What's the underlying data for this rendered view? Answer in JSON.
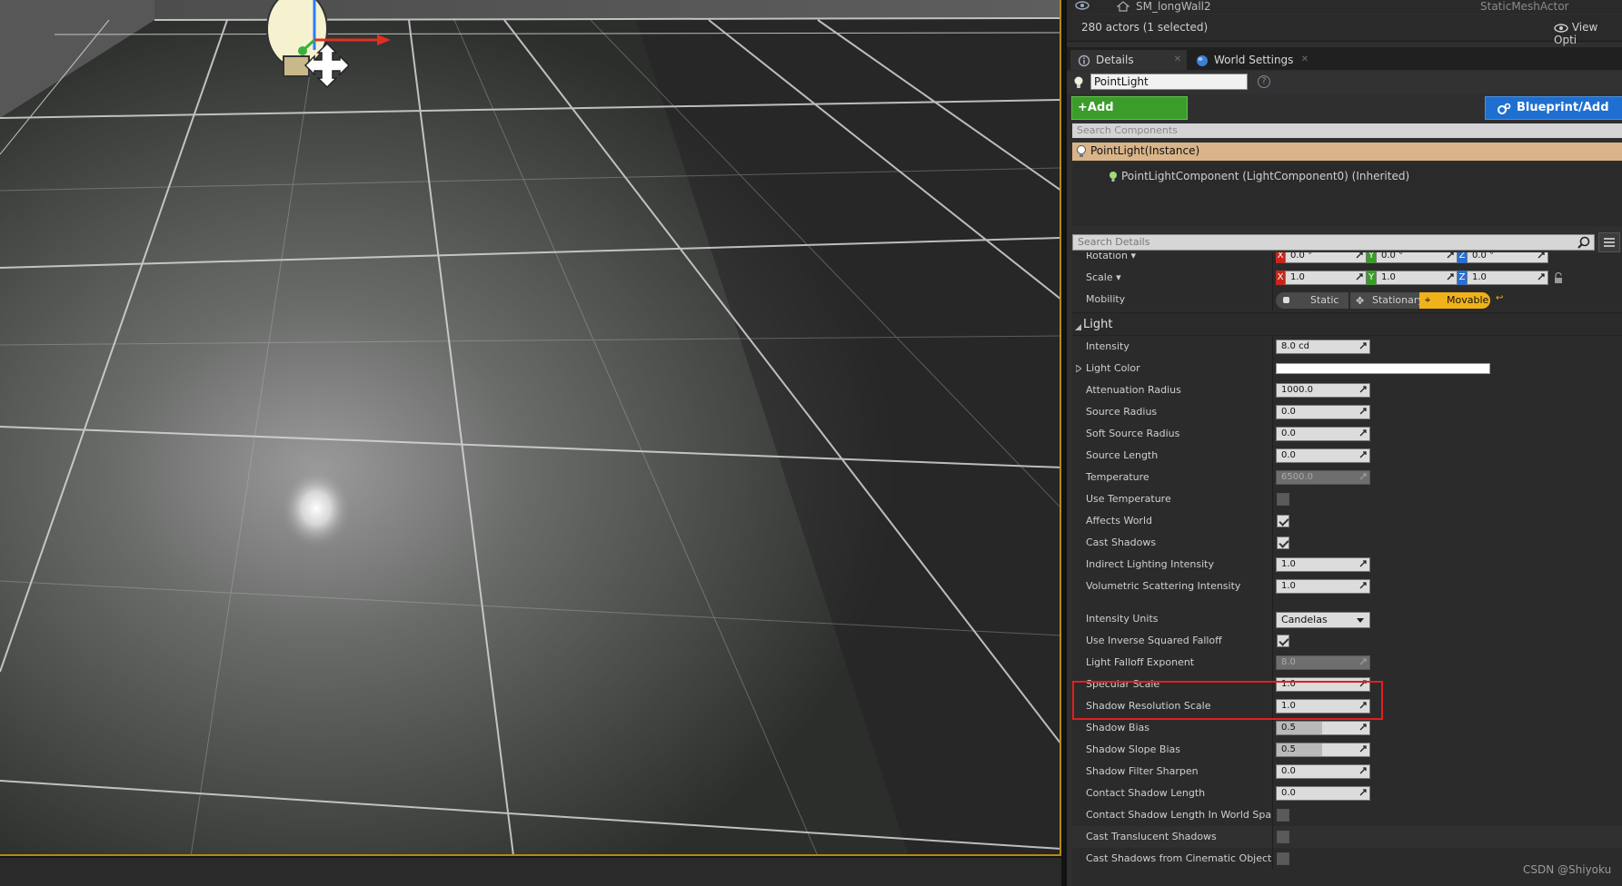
{
  "outliner": {
    "row_name": "SM_longWall2",
    "row_type": "StaticMeshActor",
    "actor_count": "280 actors (1 selected)",
    "view_options": "View Opti"
  },
  "tabs": [
    {
      "label": "Details"
    },
    {
      "label": "World Settings"
    }
  ],
  "actor_name": "PointLight",
  "toolbar": {
    "add_component": "+Add Component",
    "blueprint": "Blueprint/Add Scr"
  },
  "components": {
    "search_placeholder": "Search Components",
    "root": "PointLight(Instance)",
    "child": "PointLightComponent (LightComponent0) (Inherited)"
  },
  "details": {
    "search_placeholder": "Search Details",
    "transform": {
      "rotation_label": "Rotation",
      "rotation": {
        "x": "0.0 °",
        "y": "0.0 °",
        "z": "0.0 °"
      },
      "scale_label": "Scale",
      "scale": {
        "x": "1.0",
        "y": "1.0",
        "z": "1.0"
      },
      "mobility_label": "Mobility",
      "mobility": [
        "Static",
        "Stationary",
        "Movable"
      ]
    },
    "light_category": "Light",
    "props": {
      "intensity": {
        "label": "Intensity",
        "value": "8.0 cd"
      },
      "light_color": {
        "label": "Light Color",
        "value": "#ffffff"
      },
      "attenuation_radius": {
        "label": "Attenuation Radius",
        "value": "1000.0"
      },
      "source_radius": {
        "label": "Source Radius",
        "value": "0.0"
      },
      "soft_source_radius": {
        "label": "Soft Source Radius",
        "value": "0.0"
      },
      "source_length": {
        "label": "Source Length",
        "value": "0.0"
      },
      "temperature": {
        "label": "Temperature",
        "value": "6500.0"
      },
      "use_temperature": {
        "label": "Use Temperature"
      },
      "affects_world": {
        "label": "Affects World"
      },
      "cast_shadows": {
        "label": "Cast Shadows"
      },
      "indirect_lighting": {
        "label": "Indirect Lighting Intensity",
        "value": "1.0"
      },
      "volumetric_scattering": {
        "label": "Volumetric Scattering Intensity",
        "value": "1.0"
      },
      "intensity_units": {
        "label": "Intensity Units",
        "value": "Candelas"
      },
      "inverse_squared": {
        "label": "Use Inverse Squared Falloff"
      },
      "falloff_exponent": {
        "label": "Light Falloff Exponent",
        "value": "8.0"
      },
      "specular_scale": {
        "label": "Specular Scale",
        "value": "1.0"
      },
      "shadow_resolution_scale": {
        "label": "Shadow Resolution Scale",
        "value": "1.0"
      },
      "shadow_bias": {
        "label": "Shadow Bias",
        "value": "0.5"
      },
      "shadow_slope_bias": {
        "label": "Shadow Slope Bias",
        "value": "0.5"
      },
      "shadow_filter_sharpen": {
        "label": "Shadow Filter Sharpen",
        "value": "0.0"
      },
      "contact_shadow_length": {
        "label": "Contact Shadow Length",
        "value": "0.0"
      },
      "contact_shadow_ws": {
        "label": "Contact Shadow Length In World Space U"
      },
      "cast_translucent_shadows": {
        "label": "Cast Translucent Shadows"
      },
      "cast_cinematic": {
        "label": "Cast Shadows from Cinematic Objects O"
      }
    }
  },
  "watermark": "CSDN @Shiyoku",
  "colors": {
    "accent_orange": "#f0b21a",
    "add_green": "#3c9c2b",
    "blueprint_blue": "#1f6fd0",
    "highlight_red": "#e02020",
    "selection_tan": "#d9b489"
  }
}
